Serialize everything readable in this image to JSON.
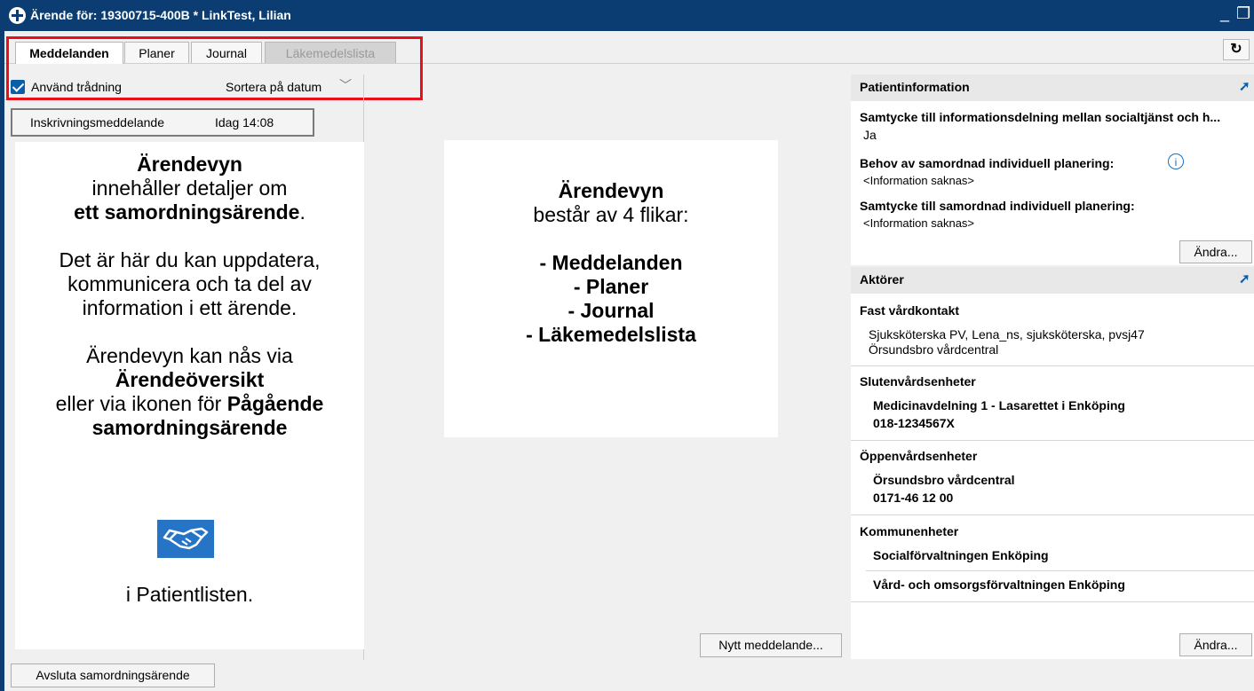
{
  "window": {
    "title": "Ärende för: 19300715-400B * LinkTest, Lilian",
    "minimize_glyph": "_",
    "restore_glyph": "❐",
    "accent": "#0b3d72"
  },
  "tabs": [
    {
      "label": "Meddelanden",
      "state": "active"
    },
    {
      "label": "Planer",
      "state": "normal"
    },
    {
      "label": "Journal",
      "state": "normal"
    },
    {
      "label": "Läkemedelslista",
      "state": "disabled"
    }
  ],
  "refresh_icon_glyph": "↻",
  "highlight_color": "#e8101c",
  "messages": {
    "threading_label": "Använd trådning",
    "threading_checked": true,
    "sort_label": "Sortera på datum",
    "sort_chevron": "﹀",
    "list": [
      {
        "title": "Inskrivningsmeddelande",
        "time": "Idag 14:08"
      }
    ],
    "new_message_button": "Nytt meddelande...",
    "close_case_button": "Avsluta samordningsärende"
  },
  "callout_left": {
    "l1": "Ärendevyn",
    "l2": "innehåller detaljer om",
    "l3a": "ett samordningsärende",
    "l3b": ".",
    "l4": "Det är här du kan uppdatera,",
    "l5": "kommunicera och ta del av",
    "l6": "information i ett ärende.",
    "l7": "Ärendevyn kan nås via",
    "l8": "Ärendeöversikt",
    "l9a": "eller via ikonen för ",
    "l9b": "Pågående",
    "l10": "samordningsärende",
    "l11": "i Patientlisten."
  },
  "callout_center": {
    "l1": "Ärendevyn",
    "l2": "består av 4 flikar:",
    "items": [
      "- Meddelanden",
      "- Planer",
      "- Journal",
      "- Läkemedelslista"
    ]
  },
  "patient_info": {
    "header": "Patientinformation",
    "consent_label": "Samtycke till informationsdelning mellan socialtjänst och h...",
    "consent_value": "Ja",
    "need_label": "Behov av samordnad individuell planering:",
    "info_glyph": "i",
    "need_value": "<Information saknas>",
    "sip_consent_label": "Samtycke till samordnad individuell planering:",
    "sip_consent_value": "<Information saknas>",
    "edit_button": "Ändra..."
  },
  "actors": {
    "header": "Aktörer",
    "fast_label": "Fast vårdkontakt",
    "fast_name": "Sjuksköterska PV, Lena_ns, sjuksköterska, pvsj47",
    "fast_unit": "Örsundsbro vårdcentral",
    "inpatient_label": "Slutenvårdsenheter",
    "inpatient_name": "Medicinavdelning 1 - Lasarettet i Enköping",
    "inpatient_phone": "018-1234567X",
    "outpatient_label": "Öppenvårdsenheter",
    "outpatient_name": "Örsundsbro vårdcentral",
    "outpatient_phone": "0171-46 12 00",
    "municipal_label": "Kommunenheter",
    "municipal_1": "Socialförvaltningen Enköping",
    "municipal_2": "Vård- och omsorgsförvaltningen Enköping",
    "edit_button": "Ändra..."
  },
  "pin_glyph": "➚"
}
